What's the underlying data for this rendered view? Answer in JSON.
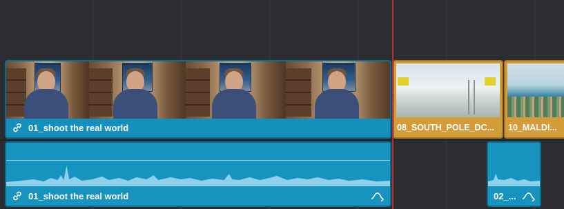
{
  "timeline": {
    "playhead_color": "#b9303a",
    "video_track": {
      "clips": [
        {
          "label": "01_shoot the real world",
          "linked": true,
          "color": "#1590bd",
          "thumbnail": "interview-frame"
        },
        {
          "label": "08_SOUTH_POLE_DC...",
          "linked": false,
          "color": "#d49b3a",
          "thumbnail": "snow-runway-frame"
        },
        {
          "label": "10_MALDI...",
          "linked": false,
          "color": "#d49b3a",
          "thumbnail": "ocean-reef-frame"
        }
      ]
    },
    "audio_track": {
      "clips": [
        {
          "label": "01_shoot the real world",
          "linked": true,
          "color": "#1693bf",
          "icons": [
            "link-icon",
            "keyframe-curve-icon"
          ]
        },
        {
          "label": "02_...",
          "linked": false,
          "color": "#1693bf",
          "icons": [
            "keyframe-curve-icon"
          ]
        }
      ]
    }
  }
}
